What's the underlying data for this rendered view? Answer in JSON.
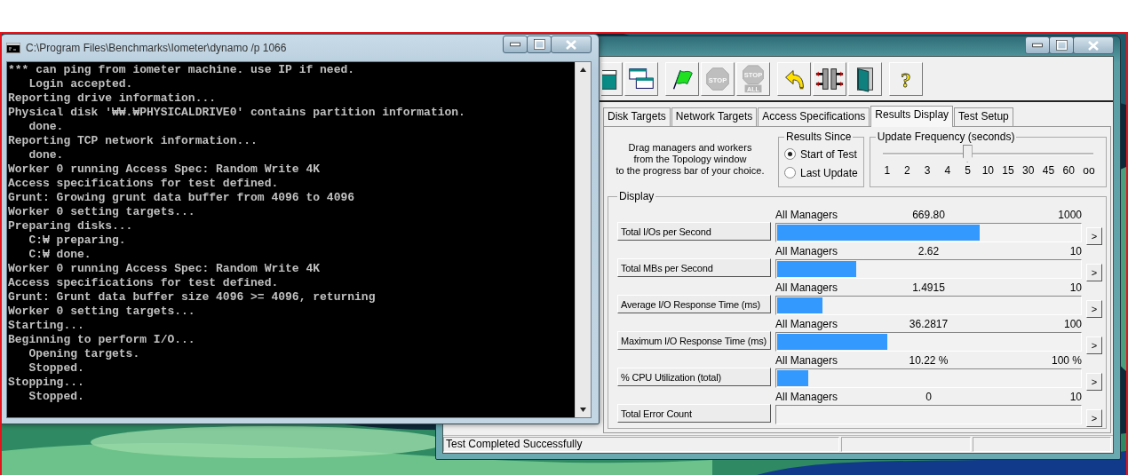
{
  "console": {
    "title": "C:\\Program Files\\Benchmarks\\Iometer\\dynamo /p 1066",
    "lines": [
      "*** can ping from iometer machine. use IP if need.",
      "   Login accepted.",
      "Reporting drive information...",
      "Physical disk '₩₩.₩PHYSICALDRIVE0' contains partition information.",
      "   done.",
      "Reporting TCP network information...",
      "   done.",
      "Worker 0 running Access Spec: Random Write 4K",
      "Access specifications for test defined.",
      "Grunt: Growing grunt data buffer from 4096 to 4096",
      "Worker 0 setting targets...",
      "Preparing disks...",
      "   C:₩ preparing.",
      "   C:₩ done.",
      "Worker 0 running Access Spec: Random Write 4K",
      "Access specifications for test defined.",
      "Grunt: Grunt data buffer size 4096 >= 4096, returning",
      "Worker 0 setting targets...",
      "Starting...",
      "Beginning to perform I/O...",
      "   Opening targets.",
      "   Stopped.",
      "Stopping...",
      "   Stopped."
    ]
  },
  "iometer": {
    "toolbar": [
      {
        "buttons": [
          {
            "kind": "window",
            "disabled": false
          },
          {
            "kind": "windows",
            "disabled": false
          }
        ]
      },
      {
        "buttons": [
          {
            "kind": "flag",
            "disabled": false
          },
          {
            "kind": "stop",
            "disabled": true,
            "label": "STOP"
          },
          {
            "kind": "stop-all",
            "disabled": true,
            "label": "STOP",
            "sublabel": "ALL"
          }
        ]
      },
      {
        "buttons": [
          {
            "kind": "arrow",
            "disabled": false
          },
          {
            "kind": "disconnect",
            "disabled": false
          },
          {
            "kind": "door",
            "disabled": false
          }
        ]
      },
      {
        "buttons": [
          {
            "kind": "help",
            "disabled": false,
            "label": "?"
          }
        ]
      }
    ],
    "tabs": [
      {
        "label": "Disk Targets",
        "selected": false
      },
      {
        "label": "Network Targets",
        "selected": false
      },
      {
        "label": "Access Specifications",
        "selected": false
      },
      {
        "label": "Results Display",
        "selected": true
      },
      {
        "label": "Test Setup",
        "selected": false
      }
    ],
    "hint": "Drag managers and workers\nfrom the Topology window\nto the progress bar of your choice.",
    "results_since": {
      "title": "Results Since",
      "options": [
        {
          "label": "Start of Test",
          "selected": true
        },
        {
          "label": "Last Update",
          "selected": false
        }
      ]
    },
    "update_frequency": {
      "title": "Update Frequency (seconds)",
      "level": 0.4,
      "ticks": [
        "1",
        "2",
        "3",
        "4",
        "5",
        "10",
        "15",
        "30",
        "45",
        "60",
        "oo"
      ]
    },
    "display": {
      "title": "Display",
      "rows": [
        {
          "label": "Total I/Os per Second",
          "scope": "All Managers",
          "value": "669.80",
          "max": "1000",
          "level": 0.67,
          "more": ">"
        },
        {
          "label": "Total MBs per Second",
          "scope": "All Managers",
          "value": "2.62",
          "max": "10",
          "level": 0.262,
          "more": ">"
        },
        {
          "label": "Average I/O Response Time (ms)",
          "scope": "All Managers",
          "value": "1.4915",
          "max": "10",
          "level": 0.149,
          "more": ">"
        },
        {
          "label": "Maximum I/O Response Time (ms)",
          "scope": "All Managers",
          "value": "36.2817",
          "max": "100",
          "level": 0.363,
          "more": ">"
        },
        {
          "label": "% CPU Utilization (total)",
          "scope": "All Managers",
          "value": "10.22 %",
          "max": "100 %",
          "level": 0.102,
          "more": ">"
        },
        {
          "label": "Total Error Count",
          "scope": "All Managers",
          "value": "0",
          "max": "10",
          "level": 0,
          "more": ">"
        }
      ]
    },
    "status_bar": {
      "text": "Test Completed Successfully"
    }
  }
}
